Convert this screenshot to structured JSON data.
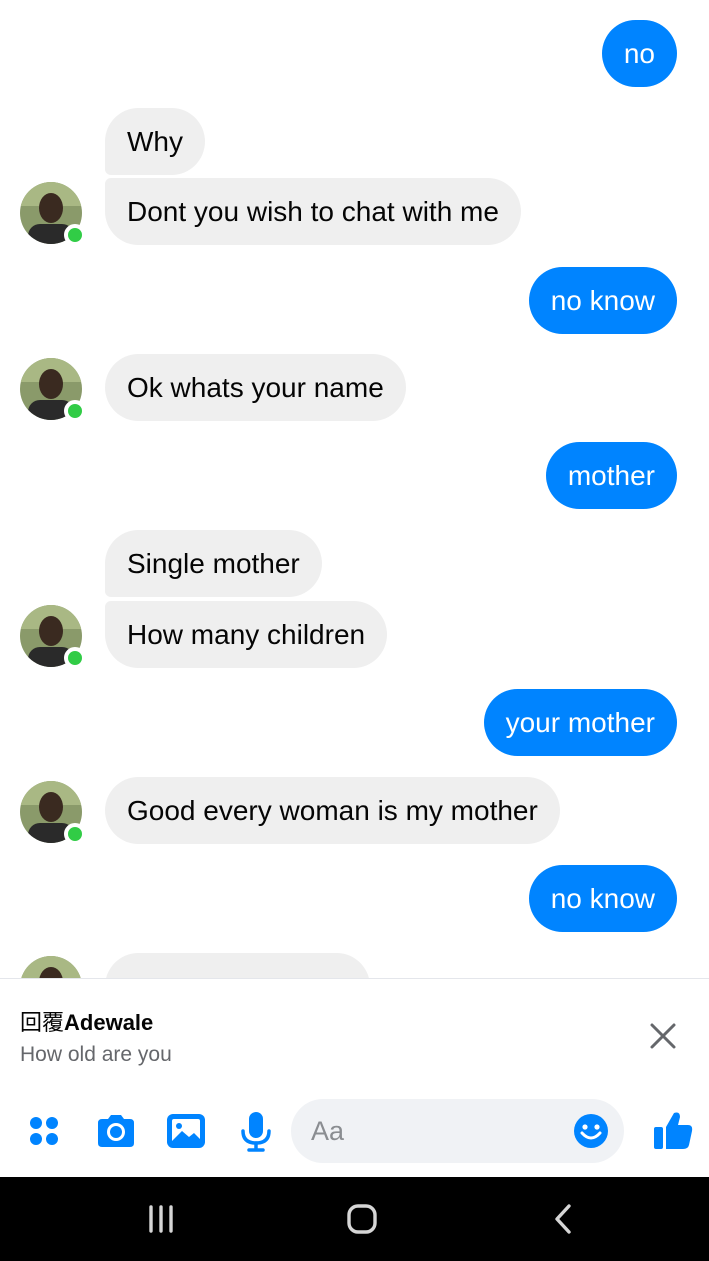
{
  "chat": {
    "messages": [
      {
        "side": "out",
        "text": "no"
      },
      {
        "side": "in",
        "text": "Why"
      },
      {
        "side": "in",
        "text": "Dont you wish to chat with me"
      },
      {
        "side": "out",
        "text": "no know"
      },
      {
        "side": "in",
        "text": "Ok whats your name"
      },
      {
        "side": "out",
        "text": "mother"
      },
      {
        "side": "in",
        "text": "Single mother"
      },
      {
        "side": "in",
        "text": "How many children"
      },
      {
        "side": "out",
        "text": "your mother"
      },
      {
        "side": "in",
        "text": "Good every woman is my mother"
      },
      {
        "side": "out",
        "text": "no know"
      }
    ]
  },
  "reply": {
    "prefix": "回覆",
    "name": "Adewale",
    "quote": "How old are you"
  },
  "composer": {
    "placeholder": "Aa",
    "icons": [
      "apps-icon",
      "camera-icon",
      "gallery-icon",
      "microphone-icon",
      "emoji-icon",
      "thumbs-up-icon"
    ]
  },
  "navbar": {
    "icons": [
      "recent-apps-icon",
      "home-icon",
      "back-icon"
    ]
  },
  "colors": {
    "outgoing": "#0084ff",
    "incoming": "#efefef",
    "online": "#31cc46"
  }
}
